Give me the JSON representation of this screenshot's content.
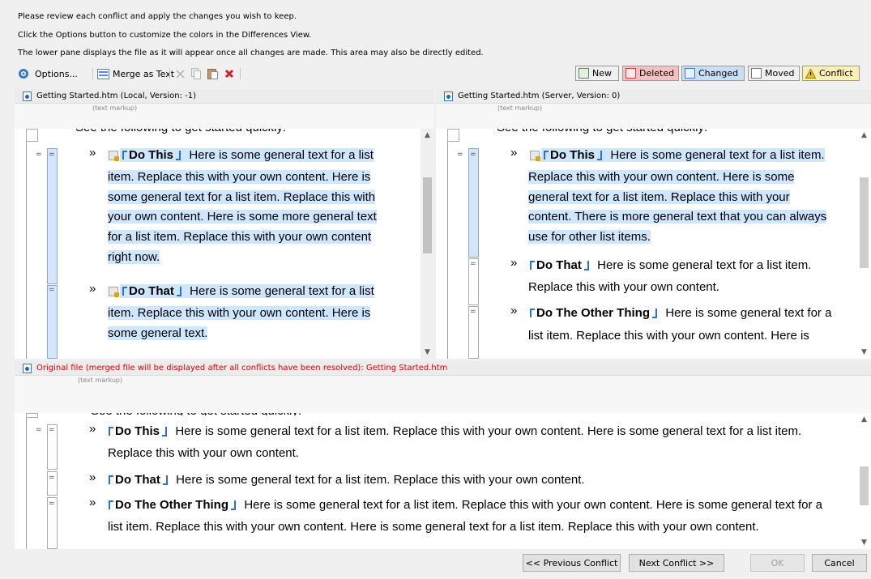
{
  "instructions": [
    "Please review each conflict and apply the changes you wish to keep.",
    "Click the Options button to customize the colors in the Differences View.",
    "The lower pane displays the file as it will appear once all changes are made. This area may also be directly edited."
  ],
  "toolbar": {
    "options_label": "Options...",
    "merge_label": "Merge as Text",
    "legend": [
      {
        "label": "New",
        "color": "#dff5d8"
      },
      {
        "label": "Deleted",
        "color": "#f7c0c0"
      },
      {
        "label": "Changed",
        "color": "#c9def5"
      },
      {
        "label": "Moved",
        "color": "#f0f0f0"
      },
      {
        "label": "Conflict",
        "color": "#faf0b4"
      }
    ]
  },
  "left_pane": {
    "title": "Getting Started.htm (Local, Version: -1)",
    "markup_label": "(text markup)",
    "cut_text": "See the following to get started quickly:",
    "items": [
      {
        "title": "Do This",
        "lines": [
          " Here is some general text for a list",
          "item. Replace this with your own content. Here is",
          "some general text for a list item. Replace this with",
          "your own content. Here is some more general text",
          "for a list item. Replace this with your own content",
          "right now."
        ]
      },
      {
        "title": "Do That",
        "lines": [
          " Here is some general text for a list",
          "item. Replace this with your own content. Here is",
          "some general text."
        ]
      }
    ]
  },
  "right_pane": {
    "title": "Getting Started.htm (Server, Version: 0)",
    "markup_label": "(text markup)",
    "cut_text": "See the following to get started quickly:",
    "items": [
      {
        "title": "Do This",
        "lines": [
          " Here is some general text for a list item.",
          "Replace this with your own content. Here is some",
          "general text for a list item. Replace this with your",
          "content. There is more general text that you can always",
          "use for other list items."
        ]
      },
      {
        "title": "Do That",
        "lines": [
          " Here is some general text for a list item.",
          "Replace this with your own content."
        ]
      },
      {
        "title": "Do The Other Thing",
        "lines": [
          " Here is some general text for a",
          "list item. Replace this with your own content. Here is"
        ]
      }
    ]
  },
  "bottom_pane": {
    "title": "Original file (merged file will be displayed after all conflicts have been resolved): Getting Started.htm",
    "title_color": "#e00000",
    "markup_label": "(text markup)",
    "items": [
      {
        "title": "Do This",
        "lines": [
          " Here is some general text for a list item. Replace this with your own content. Here is some general text for a list item.",
          "Replace this with your own content."
        ]
      },
      {
        "title": "Do That",
        "lines": [
          " Here is some general text for a list item. Replace this with your own content."
        ]
      },
      {
        "title": "Do The Other Thing",
        "lines": [
          " Here is some general text for a list item. Replace this with your own content. Here is some general text for a",
          "list item. Replace this with your own content. Here is some general text for a list item. Replace this with your own content."
        ]
      }
    ]
  },
  "buttons": {
    "prev": "<< Previous Conflict",
    "next": "Next Conflict >>",
    "ok": "OK",
    "cancel": "Cancel"
  }
}
